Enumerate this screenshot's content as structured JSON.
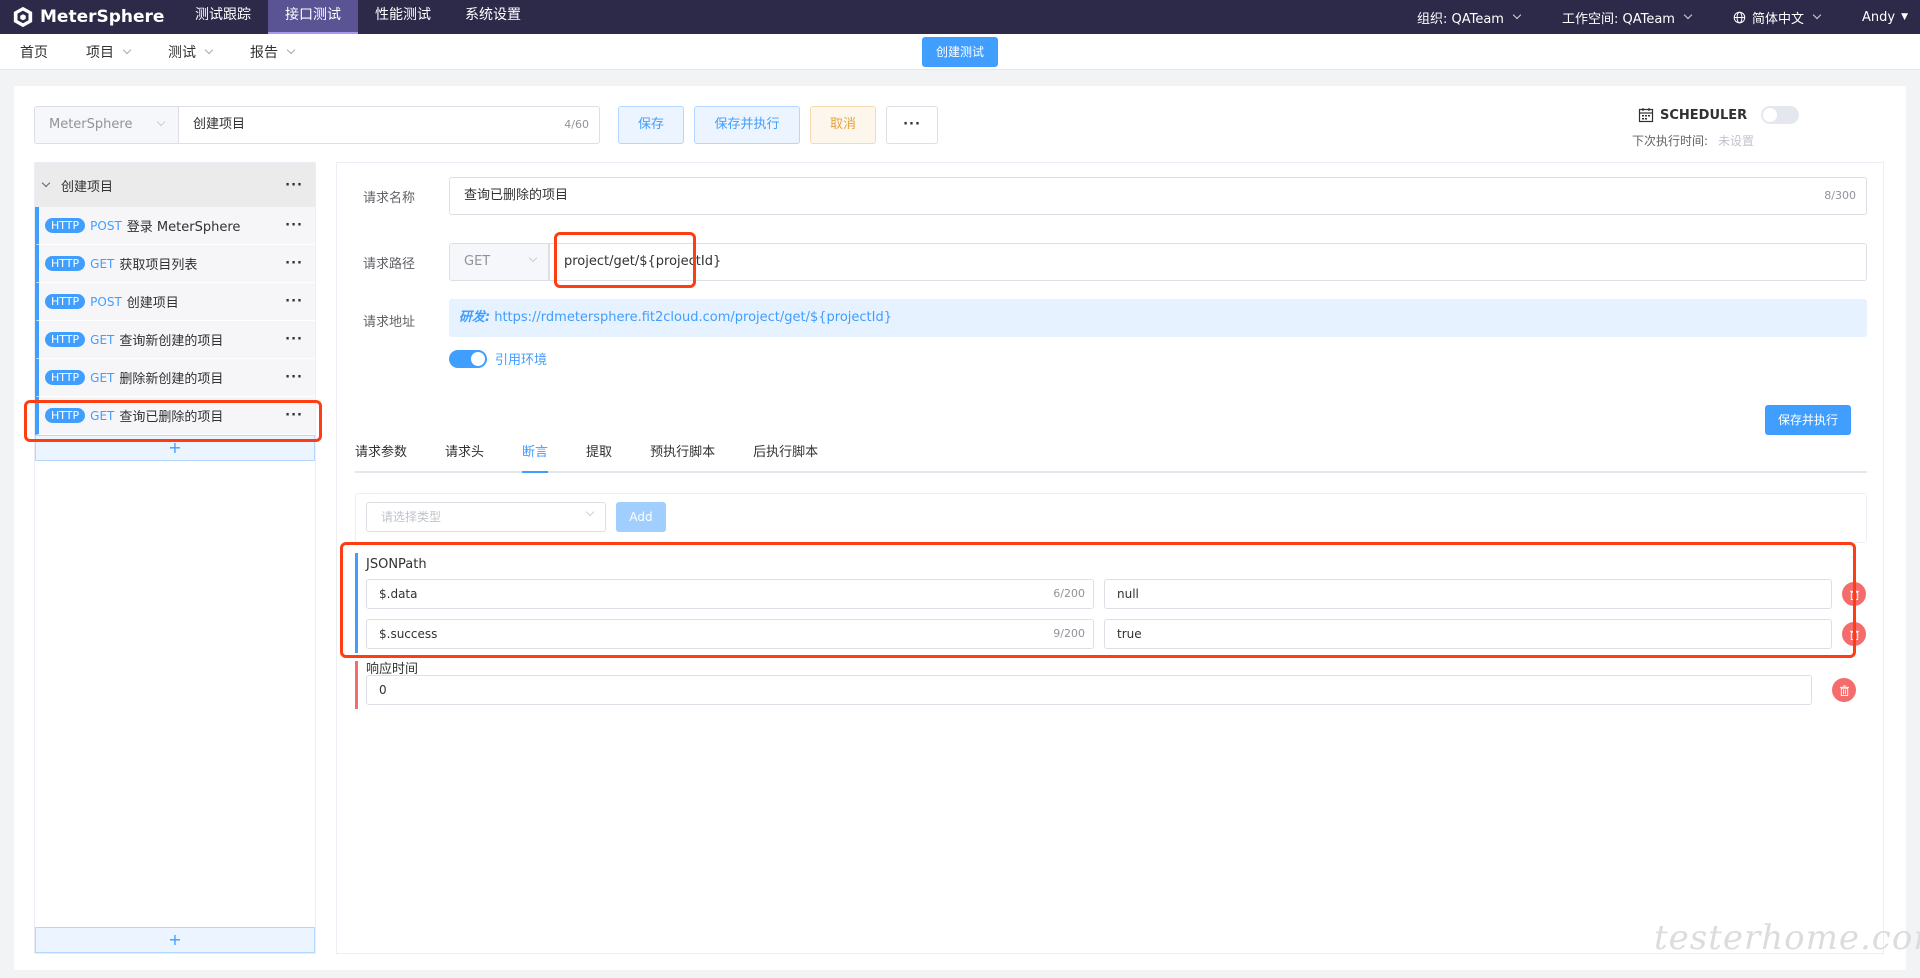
{
  "app": {
    "name": "MeterSphere"
  },
  "topnav": [
    {
      "label": "测试跟踪",
      "active": false
    },
    {
      "label": "接口测试",
      "active": true
    },
    {
      "label": "性能测试",
      "active": false
    },
    {
      "label": "系统设置",
      "active": false
    }
  ],
  "topright": {
    "org": "组织: QATeam",
    "workspace": "工作空间: QATeam",
    "language": "简体中文",
    "user": "Andy"
  },
  "subnav": {
    "home": "首页",
    "project": "项目",
    "test": "测试",
    "report": "报告",
    "create_test": "创建测试"
  },
  "scenario": {
    "project_select": "MeterSphere",
    "name": "创建项目",
    "name_count": "4/60",
    "save": "保存",
    "save_exec": "保存并执行",
    "cancel": "取消",
    "more": "···"
  },
  "scheduler": {
    "label": "SCHEDULER",
    "next_run_label": "下次执行时间:",
    "next_run_value": "未设置",
    "enabled": false
  },
  "tree": {
    "group": "创建项目",
    "items": [
      {
        "protocol": "HTTP",
        "method": "POST",
        "name": "登录 MeterSphere"
      },
      {
        "protocol": "HTTP",
        "method": "GET",
        "name": "获取项目列表"
      },
      {
        "protocol": "HTTP",
        "method": "POST",
        "name": "创建项目"
      },
      {
        "protocol": "HTTP",
        "method": "GET",
        "name": "查询新创建的项目"
      },
      {
        "protocol": "HTTP",
        "method": "GET",
        "name": "删除新创建的项目"
      },
      {
        "protocol": "HTTP",
        "method": "GET",
        "name": "查询已删除的项目"
      }
    ],
    "add": "+"
  },
  "request": {
    "name_label": "请求名称",
    "name": "查询已删除的项目",
    "name_count": "8/300",
    "path_label": "请求路径",
    "method": "GET",
    "path": "project/get/${projectId}",
    "address_label": "请求地址",
    "env_name": "研发:",
    "address": "https://rdmetersphere.fit2cloud.com/project/get/${projectId}",
    "use_env_label": "引用环境",
    "use_env": true,
    "save_exec": "保存并执行"
  },
  "tabs": [
    {
      "label": "请求参数",
      "active": false
    },
    {
      "label": "请求头",
      "active": false
    },
    {
      "label": "断言",
      "active": true
    },
    {
      "label": "提取",
      "active": false
    },
    {
      "label": "预执行脚本",
      "active": false
    },
    {
      "label": "后执行脚本",
      "active": false
    }
  ],
  "assertions": {
    "type_placeholder": "请选择类型",
    "add": "Add",
    "jsonpath_title": "JSONPath",
    "jsonpath": [
      {
        "expression": "$.data",
        "count": "6/200",
        "expected": "null"
      },
      {
        "expression": "$.success",
        "count": "9/200",
        "expected": "true"
      }
    ],
    "response_time_label": "响应时间",
    "response_time": "0"
  },
  "watermark": "testerhome.com",
  "colors": {
    "topbar": "#2c2a48",
    "primary": "#409eff",
    "highlight": "#ff3d12",
    "danger": "#f56c6c"
  }
}
